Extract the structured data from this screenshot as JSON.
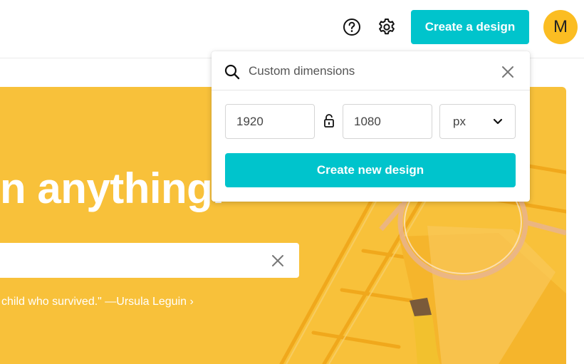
{
  "header": {
    "help_icon": "question-circle-icon",
    "settings_icon": "gear-icon",
    "create_design_label": "Create a design",
    "avatar_initial": "M",
    "accent_color": "#00c4cc",
    "avatar_color": "#fbbd22"
  },
  "hero": {
    "headline": "n anything.",
    "search_value": "",
    "quote": "child who survived.\" —Ursula Leguin ›",
    "background_color": "#f8c13a"
  },
  "custom_dimensions": {
    "search_placeholder": "Custom dimensions",
    "width_value": "1920",
    "height_value": "1080",
    "unit_selected": "px",
    "create_button_label": "Create new design"
  }
}
